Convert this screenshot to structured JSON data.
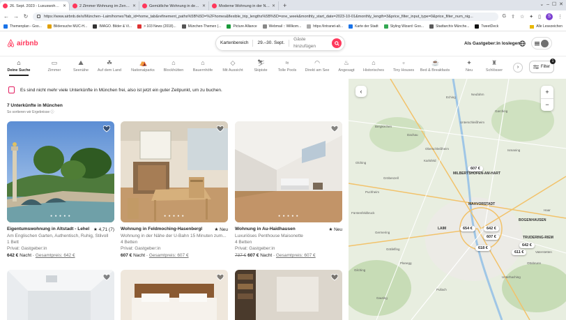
{
  "browser": {
    "tabs": [
      {
        "title": "26. Sept. 2023 - Luxuswohnungen",
        "active": true
      },
      {
        "title": "2 Zimmer Wohnung im Zentrum",
        "active": false
      },
      {
        "title": "Gemütliche Wohnung in der Näh",
        "active": false
      },
      {
        "title": "Moderne Wohnung in der Nähe",
        "active": false
      }
    ],
    "url": "https://www.airbnb.de/s/München--Laim/homes?tab_id=home_tab&refinement_paths%5B%5D=%2Fhomes&flexible_trip_lengths%5B%5D=one_week&monthly_start_date=2023-10-01&monthly_length=3&price_filter_input_type=0&price_filter_num_nig...",
    "bookmarks": [
      "Themenplan - Goo...",
      "Bildersuche MUC-H...",
      "IMAGO. Bilder & Vi...",
      "> 103 News (2018)...",
      "München-Themen (...",
      "Picture Alliance",
      "Webmail :: Willkom...",
      "https://intranet-alt...",
      "Karte der Stadt",
      "Styling Wizard: Goo...",
      "Stadtarchiv Münche...",
      "TweetDeck"
    ],
    "bookmarks_right": "Alle Lesezeichen",
    "profile_initial": "S"
  },
  "header": {
    "logo_text": "airbnb",
    "search_location": "Kartenbereich",
    "search_dates": "29.–30. Sept.",
    "search_guests": "Gäste hinzufügen",
    "host_link": "Als Gastgeber:in loslegen"
  },
  "categories": [
    "Deine Suche",
    "Zimmer",
    "Seenähe",
    "Auf dem Land",
    "Nationalparks",
    "Blockhütten",
    "Bauernhöfe",
    "Mit Aussicht",
    "Skipiste",
    "Tolle Pools",
    "Direkt am See",
    "Angesagt",
    "Historisches",
    "Tiny Houses",
    "Bed & Breakfasts",
    "Neu",
    "Schlösser"
  ],
  "filter": {
    "label": "Filter",
    "count": "1"
  },
  "notice": "Es sind nicht mehr viele Unterkünfte in München frei, also ist jetzt ein guter Zeitpunkt, um zu buchen.",
  "results_count": "7 Unterkünfte in München",
  "sort_note": "So sortieren wir Ergebnisse",
  "listings": [
    {
      "title": "Eigentumswohnung in Altstadt - Lehel",
      "rating": "★ 4,71 (7)",
      "l1": "Am Englischen Garten, Authentisch, Ruhig, Stilvoll",
      "l2": "1 Bett",
      "l3": "Privat: Gastgeber:in",
      "old_price": "",
      "price": "642 €",
      "per": "Nacht",
      "total": "Gesamtpreis: 642 €"
    },
    {
      "title": "Wohnung in Feldmoching-Hasenbergl",
      "rating": "★ Neu",
      "l1": "Wohnung in der Nähe der U-Bahn 15 Minuten zum...",
      "l2": "4 Betten",
      "l3": "Privat: Gastgeber:in",
      "old_price": "",
      "price": "607 €",
      "per": "Nacht",
      "total": "Gesamtpreis: 607 €"
    },
    {
      "title": "Wohnung in Au-Haidhausen",
      "rating": "★ Neu",
      "l1": "Luxuriöses Penthouse Maisonette",
      "l2": "4 Betten",
      "l3": "Privat: Gastgeber:in",
      "old_price": "737 €",
      "price": "607 €",
      "per": "Nacht",
      "total": "Gesamtpreis: 607 €"
    }
  ],
  "map": {
    "pins": [
      "607 €",
      "654 €",
      "642 €",
      "607 €",
      "618 €",
      "642 €",
      "611 €"
    ],
    "labels": [
      "Oberschleißheim",
      "Karlsfeld",
      "Dachau",
      "Bergkirchen",
      "Unterschleißheim",
      "Ismaning",
      "Garching",
      "MILBERTSHOFEN-AM-HART",
      "MAXVORSTADT",
      "BOGENHAUSEN",
      "TRUDERING-RIEM",
      "LAIM",
      "Germering",
      "Planegg",
      "Unterhaching",
      "Ottobrunn",
      "Gräfelfing",
      "Gilching",
      "Gauting",
      "Pullach",
      "Haar",
      "Vaterstetten",
      "Eching",
      "Neufahrn",
      "Puchheim",
      "Olching",
      "Gröbenzell",
      "Fürstenfeldbruck"
    ]
  }
}
